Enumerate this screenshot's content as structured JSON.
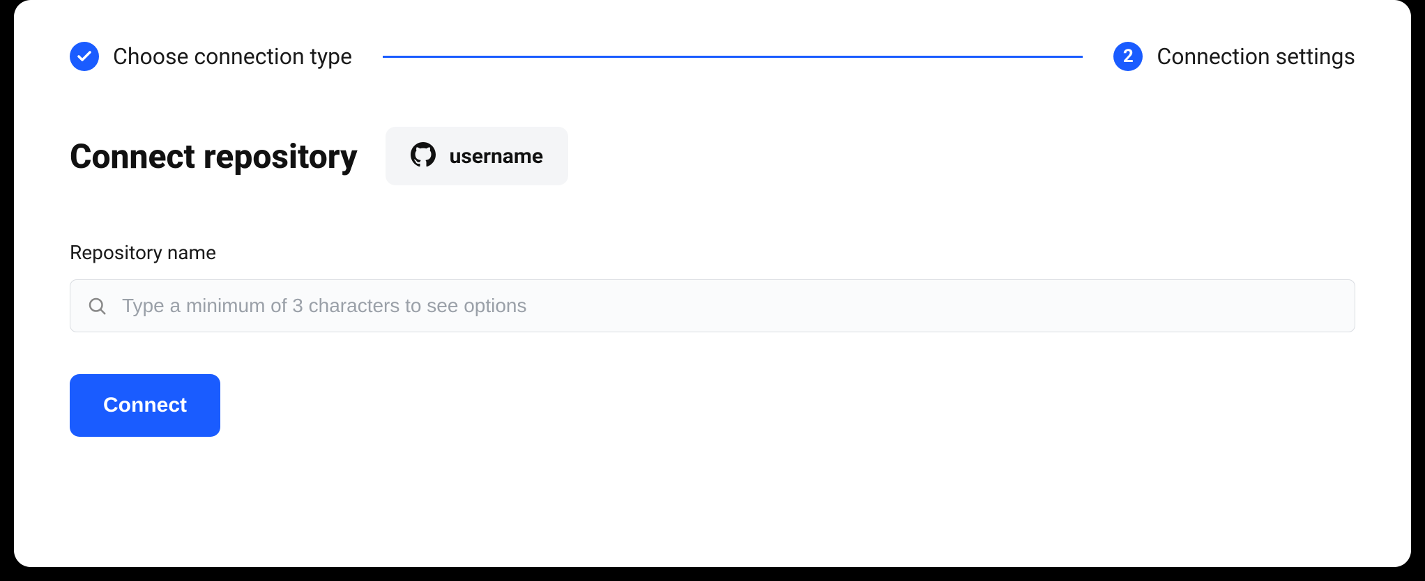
{
  "stepper": {
    "steps": [
      {
        "label": "Choose connection type",
        "status": "complete"
      },
      {
        "label": "Connection settings",
        "status": "current",
        "number": "2"
      }
    ]
  },
  "header": {
    "title": "Connect repository",
    "user_badge": {
      "provider_icon": "github-icon",
      "username": "username"
    }
  },
  "form": {
    "repository_label": "Repository name",
    "repository_placeholder": "Type a minimum of 3 characters to see options",
    "repository_value": "",
    "connect_button_label": "Connect"
  },
  "colors": {
    "accent": "#1a5cff"
  }
}
